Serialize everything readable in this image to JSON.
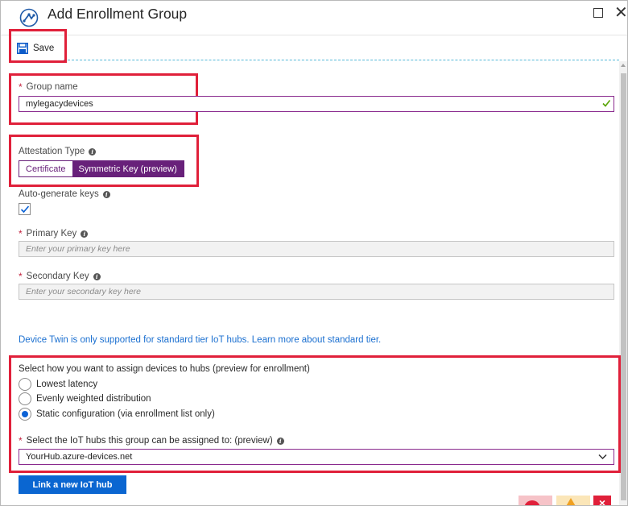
{
  "window": {
    "title": "Add Enrollment Group",
    "logo_icon": "iot-hub-dps-icon",
    "maximize_icon": "maximize-icon",
    "close_icon": "close-icon",
    "close_glyph": "✕"
  },
  "toolbar": {
    "save_label": "Save",
    "save_icon": "floppy-disk-icon"
  },
  "form": {
    "group_name": {
      "required_mark": "*",
      "label": "Group name",
      "value": "mylegacydevices",
      "valid_icon": "checkmark-icon"
    },
    "attestation": {
      "label": "Attestation Type",
      "options": [
        "Certificate",
        "Symmetric Key (preview)"
      ],
      "selected": "Symmetric Key (preview)"
    },
    "auto_generate": {
      "label": "Auto-generate keys",
      "checked": true
    },
    "primary_key": {
      "required_mark": "*",
      "label": "Primary Key",
      "placeholder": "Enter your primary key here"
    },
    "secondary_key": {
      "required_mark": "*",
      "label": "Secondary Key",
      "placeholder": "Enter your secondary key here"
    },
    "device_twin_note": "Device Twin is only supported for standard tier IoT hubs. Learn more about standard tier.",
    "assignment": {
      "label": "Select how you want to assign devices to hubs (preview for enrollment)",
      "options": [
        "Lowest latency",
        "Evenly weighted distribution",
        "Static configuration (via enrollment list only)"
      ],
      "selected_index": 2
    },
    "iot_hubs": {
      "required_mark": "*",
      "label": "Select the IoT hubs this group can be assigned to: (preview)",
      "selected_value": "YourHub.azure-devices.net"
    },
    "link_button_label": "Link a new IoT hub"
  },
  "info_glyph": "i",
  "colors": {
    "accent_purple": "#68217a",
    "primary_blue": "#0a66d1",
    "highlight_red": "#e0203a",
    "link_blue": "#1a6fd0",
    "valid_green": "#57a300"
  }
}
